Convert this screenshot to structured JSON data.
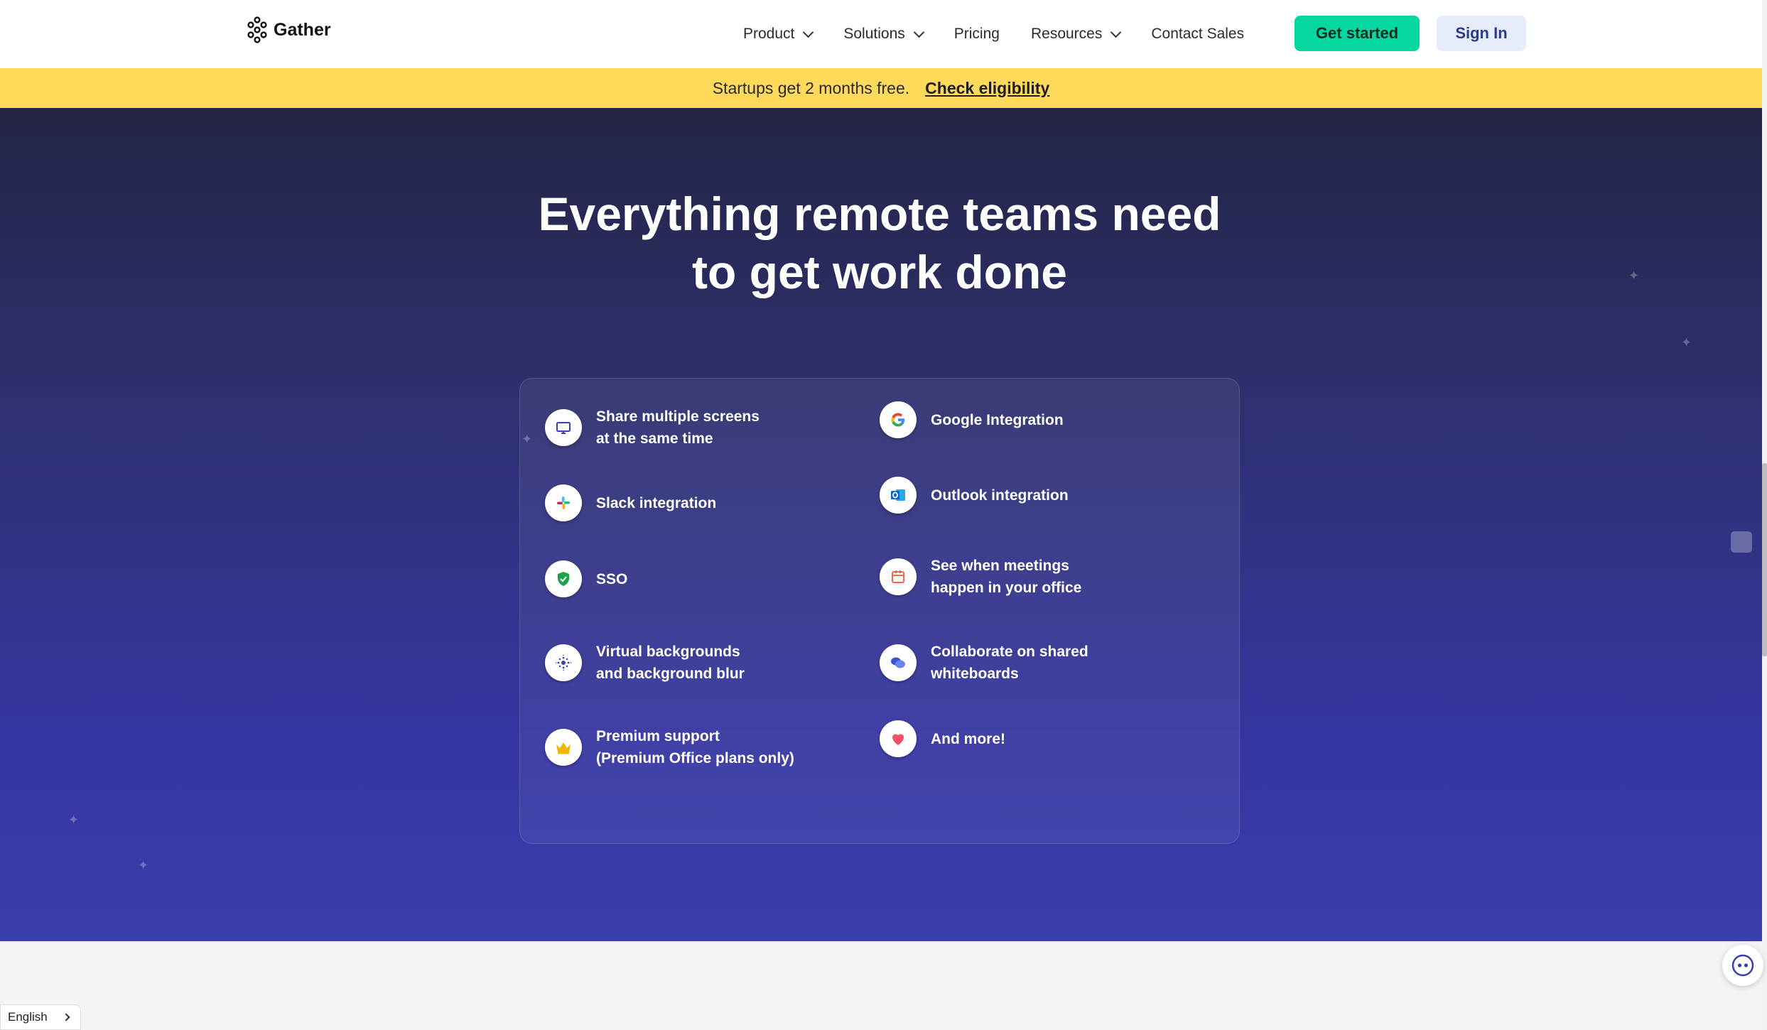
{
  "nav": {
    "brand": "Gather",
    "links": [
      {
        "label": "Product",
        "has_dropdown": true
      },
      {
        "label": "Solutions",
        "has_dropdown": true
      },
      {
        "label": "Pricing",
        "has_dropdown": false
      },
      {
        "label": "Resources",
        "has_dropdown": true
      },
      {
        "label": "Contact Sales",
        "has_dropdown": false
      }
    ],
    "get_started": "Get started",
    "sign_in": "Sign In"
  },
  "promo": {
    "text": "Startups get 2 months free.",
    "link": "Check eligibility"
  },
  "hero": {
    "title_line1": "Everything remote teams need",
    "title_line2": "to get work done"
  },
  "features": [
    {
      "icon": "monitor-icon",
      "line1": "Share multiple screens",
      "line2": "at the same time"
    },
    {
      "icon": "google-icon",
      "line1": "Google Integration",
      "line2": ""
    },
    {
      "icon": "slack-icon",
      "line1": "Slack integration",
      "line2": ""
    },
    {
      "icon": "outlook-icon",
      "line1": "Outlook integration",
      "line2": ""
    },
    {
      "icon": "shield-icon",
      "line1": "SSO",
      "line2": ""
    },
    {
      "icon": "calendar-icon",
      "line1": "See when meetings",
      "line2": "happen in your office"
    },
    {
      "icon": "blur-icon",
      "line1": "Virtual backgrounds",
      "line2": "and background blur"
    },
    {
      "icon": "chat-bubbles-icon",
      "line1": "Collaborate on shared",
      "line2": "whiteboards"
    },
    {
      "icon": "crown-icon",
      "line1": "Premium support",
      "line2": "(Premium Office plans only)"
    },
    {
      "icon": "heart-icon",
      "line1": "And more!",
      "line2": ""
    }
  ],
  "footer": {
    "language": "English"
  },
  "colors": {
    "primary_button": "#06d6a0",
    "secondary_button": "#e7ecfb",
    "promo_bar": "#ffd95a",
    "hero_top": "#232445",
    "hero_bottom": "#3b3eae"
  }
}
